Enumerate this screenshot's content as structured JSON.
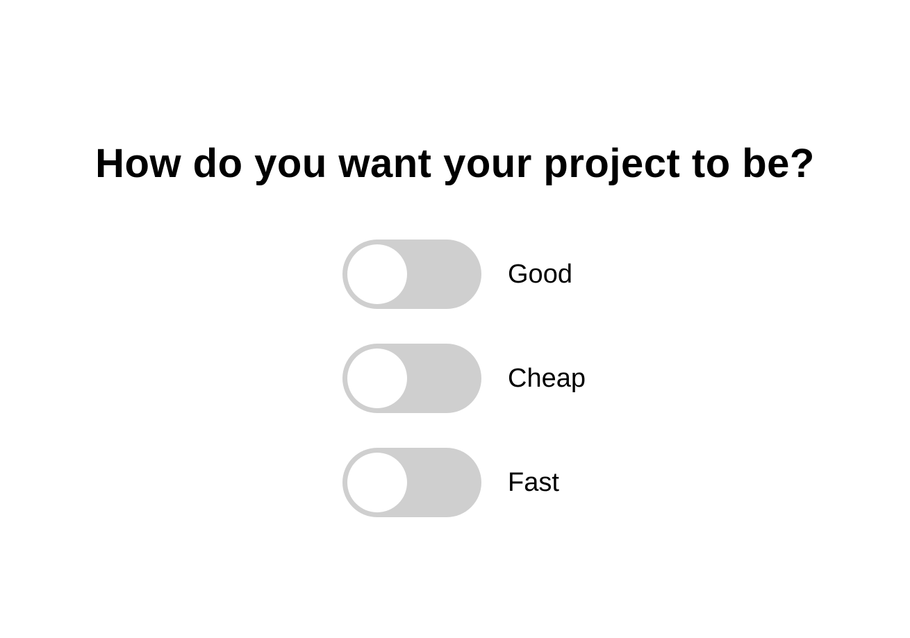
{
  "title": "How do you want your project to be?",
  "colors": {
    "track_off": "#cfcfcf",
    "knob": "#ffffff",
    "text": "#000000",
    "background": "#ffffff"
  },
  "options": [
    {
      "label": "Good",
      "checked": false
    },
    {
      "label": "Cheap",
      "checked": false
    },
    {
      "label": "Fast",
      "checked": false
    }
  ]
}
